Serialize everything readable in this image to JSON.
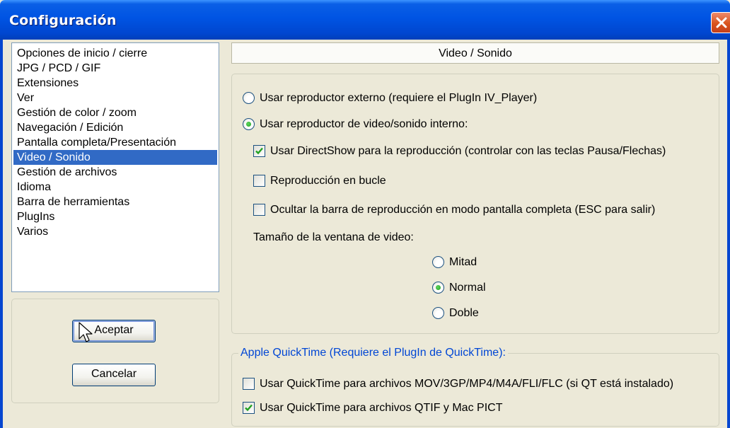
{
  "window": {
    "title": "Configuración"
  },
  "sidebar": {
    "items": [
      {
        "label": "Opciones de inicio / cierre",
        "selected": false
      },
      {
        "label": "JPG / PCD / GIF",
        "selected": false
      },
      {
        "label": "Extensiones",
        "selected": false
      },
      {
        "label": "Ver",
        "selected": false
      },
      {
        "label": "Gestión de color / zoom",
        "selected": false
      },
      {
        "label": "Navegación / Edición",
        "selected": false
      },
      {
        "label": "Pantalla completa/Presentación",
        "selected": false
      },
      {
        "label": "Video / Sonido",
        "selected": true
      },
      {
        "label": "Gestión de archivos",
        "selected": false
      },
      {
        "label": "Idioma",
        "selected": false
      },
      {
        "label": "Barra de herramientas",
        "selected": false
      },
      {
        "label": "PlugIns",
        "selected": false
      },
      {
        "label": "Varios",
        "selected": false
      }
    ]
  },
  "buttons": {
    "ok": "Aceptar",
    "cancel": "Cancelar"
  },
  "panel": {
    "header": "Video / Sonido",
    "external_player": {
      "label": "Usar reproductor externo (requiere el PlugIn IV_Player)",
      "selected": false
    },
    "internal_player": {
      "label": "Usar reproductor de video/sonido interno:",
      "selected": true
    },
    "directshow": {
      "label": "Usar DirectShow para la reproducción (controlar con las teclas Pausa/Flechas)",
      "checked": true
    },
    "loop": {
      "label": "Reproducción en bucle",
      "checked": false
    },
    "hide_bar": {
      "label": "Ocultar la barra de reproducción en modo pantalla completa (ESC para salir)",
      "checked": false
    },
    "window_size_label": "Tamaño de la ventana de video:",
    "size_half": {
      "label": "Mitad",
      "selected": false
    },
    "size_normal": {
      "label": "Normal",
      "selected": true
    },
    "size_double": {
      "label": "Doble",
      "selected": false
    }
  },
  "quicktime": {
    "legend": "Apple QuickTime (Requiere el PlugIn de QuickTime):",
    "mov": {
      "label": "Usar QuickTime para archivos MOV/3GP/MP4/M4A/FLI/FLC (si QT está instalado)",
      "checked": false
    },
    "qtif": {
      "label": "Usar QuickTime para archivos QTIF y Mac PICT",
      "checked": true
    }
  },
  "colors": {
    "selection": "#316ac5",
    "titlebar": "#0054e3",
    "group_legend": "#0046d5",
    "face": "#ece9d8"
  }
}
